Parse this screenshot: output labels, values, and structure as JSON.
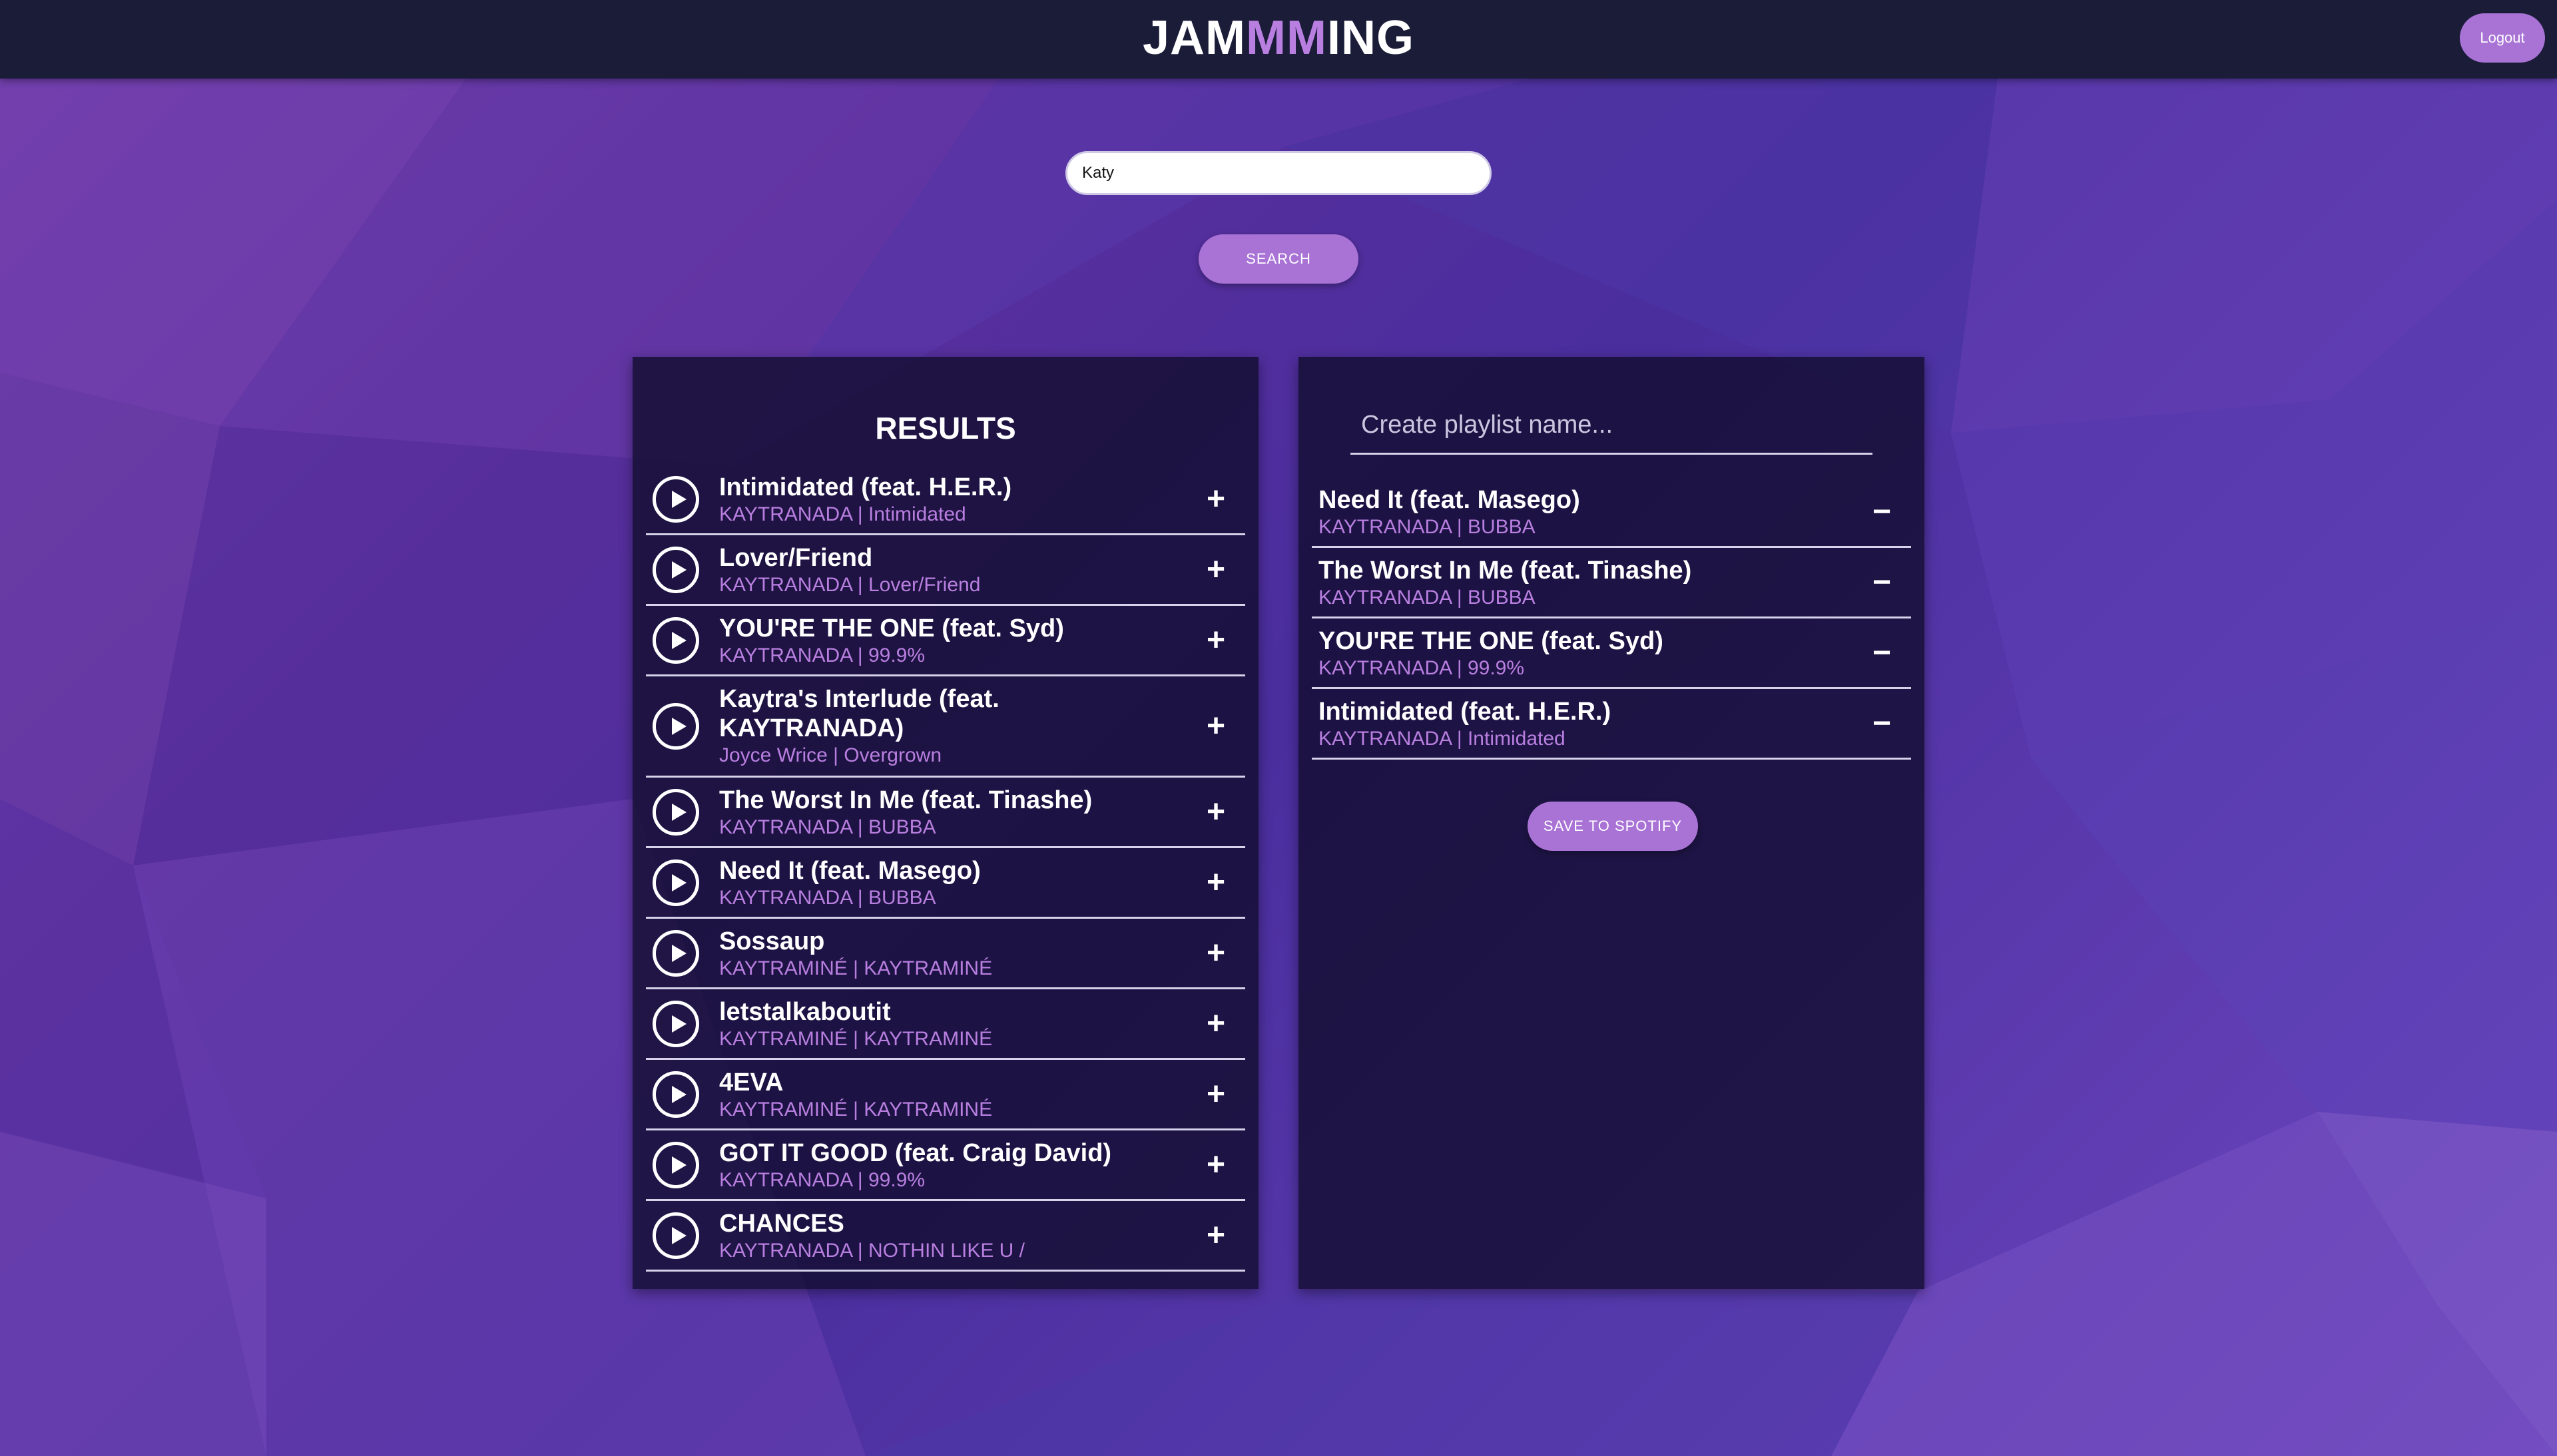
{
  "header": {
    "brand_prefix": "JAM",
    "brand_highlight": "MM",
    "brand_suffix": "ING",
    "logout_label": "Logout"
  },
  "search": {
    "value": "Katy",
    "button_label": "SEARCH"
  },
  "results": {
    "title": "RESULTS",
    "tracks": [
      {
        "name": "Intimidated (feat. H.E.R.)",
        "artist": "KAYTRANADA",
        "album": "Intimidated"
      },
      {
        "name": "Lover/Friend",
        "artist": "KAYTRANADA",
        "album": "Lover/Friend"
      },
      {
        "name": "YOU'RE THE ONE (feat. Syd)",
        "artist": "KAYTRANADA",
        "album": "99.9%"
      },
      {
        "name": "Kaytra's Interlude (feat. KAYTRANADA)",
        "artist": "Joyce Wrice",
        "album": "Overgrown"
      },
      {
        "name": "The Worst In Me (feat. Tinashe)",
        "artist": "KAYTRANADA",
        "album": "BUBBA"
      },
      {
        "name": "Need It (feat. Masego)",
        "artist": "KAYTRANADA",
        "album": "BUBBA"
      },
      {
        "name": "Sossaup",
        "artist": "KAYTRAMINÉ",
        "album": "KAYTRAMINÉ"
      },
      {
        "name": "letstalkaboutit",
        "artist": "KAYTRAMINÉ",
        "album": "KAYTRAMINÉ"
      },
      {
        "name": "4EVA",
        "artist": "KAYTRAMINÉ",
        "album": "KAYTRAMINÉ"
      },
      {
        "name": "GOT IT GOOD (feat. Craig David)",
        "artist": "KAYTRANADA",
        "album": "99.9%"
      },
      {
        "name": "CHANCES",
        "artist": "KAYTRANADA",
        "album": "NOTHIN LIKE U /"
      }
    ],
    "add_symbol": "+"
  },
  "playlist": {
    "name_placeholder": "Create playlist name...",
    "tracks": [
      {
        "name": "Need It (feat. Masego)",
        "artist": "KAYTRANADA",
        "album": "BUBBA"
      },
      {
        "name": "The Worst In Me (feat. Tinashe)",
        "artist": "KAYTRANADA",
        "album": "BUBBA"
      },
      {
        "name": "YOU'RE THE ONE (feat. Syd)",
        "artist": "KAYTRANADA",
        "album": "99.9%"
      },
      {
        "name": "Intimidated (feat. H.E.R.)",
        "artist": "KAYTRANADA",
        "album": "Intimidated"
      }
    ],
    "remove_symbol": "−",
    "save_label": "SAVE TO SPOTIFY"
  },
  "colors": {
    "accent": "#a973d6",
    "header_bg": "#1a1c38",
    "panel_bg": "#120e30",
    "meta_text": "#b97fe0"
  }
}
